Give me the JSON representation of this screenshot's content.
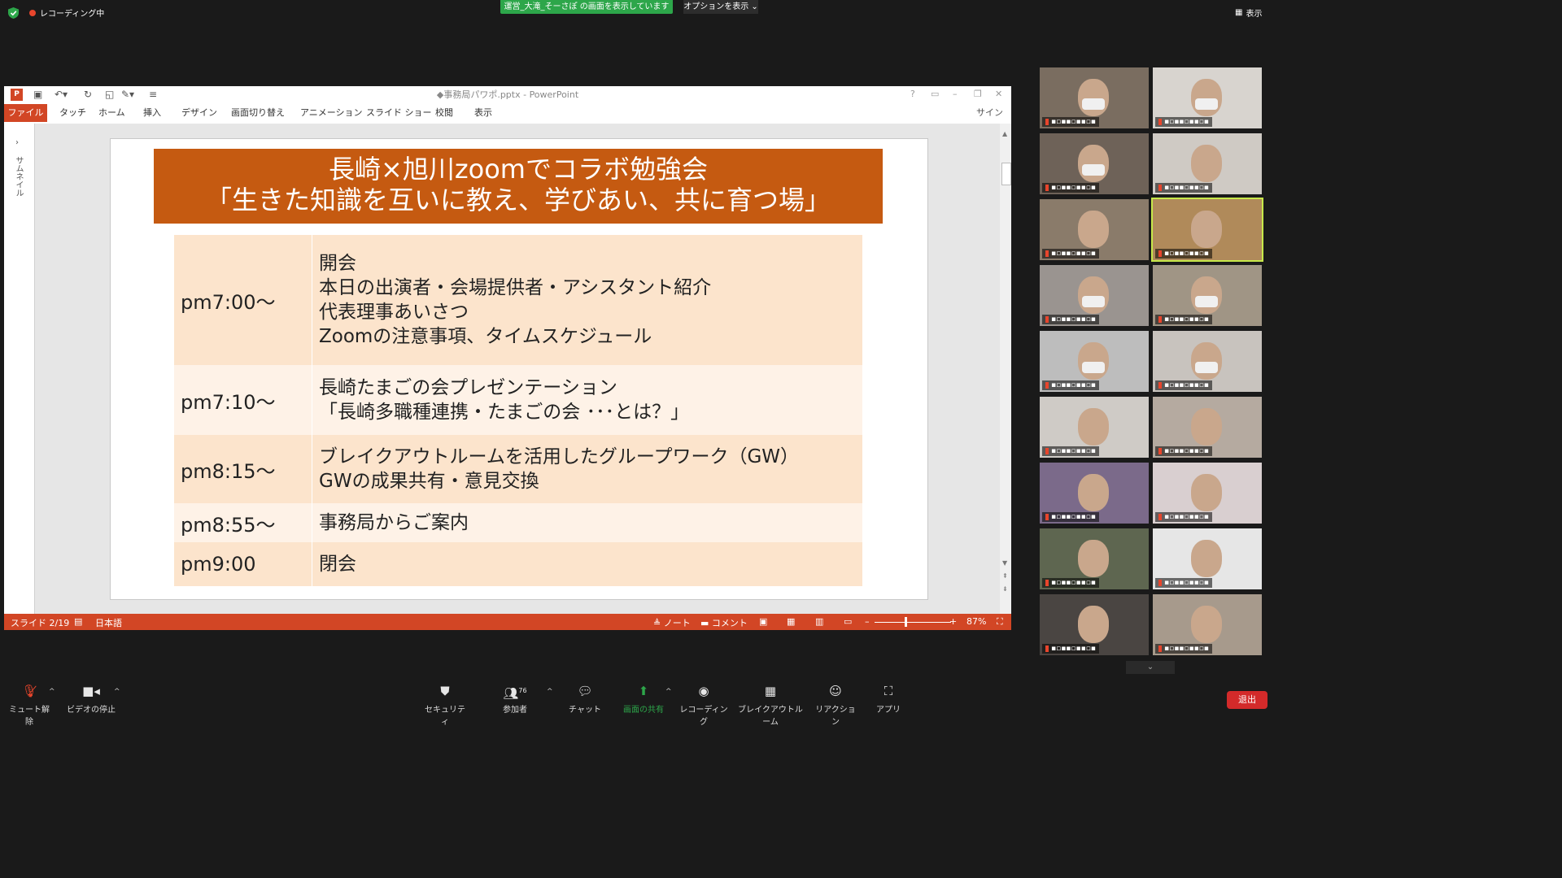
{
  "top": {
    "recording": "レコーディング中",
    "share_banner": "運営_大滝_そーさぽ の画面を表示しています",
    "options": "オプションを表示 ⌄",
    "view": "表示"
  },
  "ppt": {
    "title": "◆事務局パワポ.pptx - PowerPoint",
    "tabs": [
      "ファイル",
      "タッチ",
      "ホーム",
      "挿入",
      "デザイン",
      "画面切り替え",
      "アニメーション",
      "スライド ショー",
      "校閲",
      "表示"
    ],
    "signin": "サインイン",
    "thumbnail_label": "サムネイル",
    "slide": {
      "title_line1": "長崎×旭川zoomでコラボ勉強会",
      "title_line2": "「生きた知識を互いに教え、学びあい、共に育つ場」",
      "schedule": [
        {
          "time": "pm7:00～",
          "items": [
            "開会",
            "本日の出演者・会場提供者・アシスタント紹介",
            "代表理事あいさつ",
            "Zoomの注意事項、タイムスケジュール"
          ]
        },
        {
          "time": "pm7:10～",
          "items": [
            "長崎たまごの会プレゼンテーション",
            "「長崎多職種連携・たまごの会 ･･･とは？」"
          ]
        },
        {
          "time": "pm8:15～",
          "items": [
            "ブレイクアウトルームを活用したグループワーク（GW）",
            "GWの成果共有・意見交換"
          ]
        },
        {
          "time": "pm8:55～",
          "items": [
            "事務局からご案内"
          ]
        },
        {
          "time": "pm9:00",
          "items": [
            "閉会"
          ]
        }
      ]
    },
    "status": {
      "slide_num": "スライド 2/19",
      "language": "日本語",
      "notes": "ノート",
      "comments": "コメント",
      "zoom": "87%",
      "zoom_level": 0.87
    }
  },
  "gallery": {
    "tiles": [
      {
        "bg": "#7a6d60",
        "mask": true
      },
      {
        "bg": "#d8d4cf",
        "mask": true
      },
      {
        "bg": "#6e6258",
        "mask": true
      },
      {
        "bg": "#cfcac4",
        "mask": false
      },
      {
        "bg": "#8a7b6a",
        "mask": false
      },
      {
        "bg": "#b08a5a",
        "mask": false,
        "active": true
      },
      {
        "bg": "#9a9490",
        "mask": true
      },
      {
        "bg": "#a09585",
        "mask": true
      },
      {
        "bg": "#bdbdbd",
        "mask": true
      },
      {
        "bg": "#c8c3be",
        "mask": true
      },
      {
        "bg": "#cfcbc6",
        "mask": false
      },
      {
        "bg": "#b5aaa0",
        "mask": false
      },
      {
        "bg": "#7b6a8a",
        "mask": false
      },
      {
        "bg": "#d9cfd0",
        "mask": false
      },
      {
        "bg": "#5e6650",
        "mask": false
      },
      {
        "bg": "#e6e6e6",
        "mask": false
      },
      {
        "bg": "#4a4542",
        "mask": false
      },
      {
        "bg": "#a79a8c",
        "mask": false
      }
    ],
    "colors": {
      "active_outline": "#c7e84a"
    }
  },
  "toolbar": {
    "mute": "ミュート解除",
    "video": "ビデオの停止",
    "security": "セキュリティ",
    "participants": "参加者",
    "participants_count": "76",
    "chat": "チャット",
    "share": "画面の共有",
    "record": "レコーディング",
    "breakout": "ブレイクアウトルーム",
    "reactions": "リアクション",
    "apps": "アプリ",
    "leave": "退出"
  },
  "colors": {
    "ppt_accent": "#d24625",
    "slide_title_bg": "#c55a11",
    "share_green": "#2da64a",
    "leave_red": "#d32a2a"
  }
}
